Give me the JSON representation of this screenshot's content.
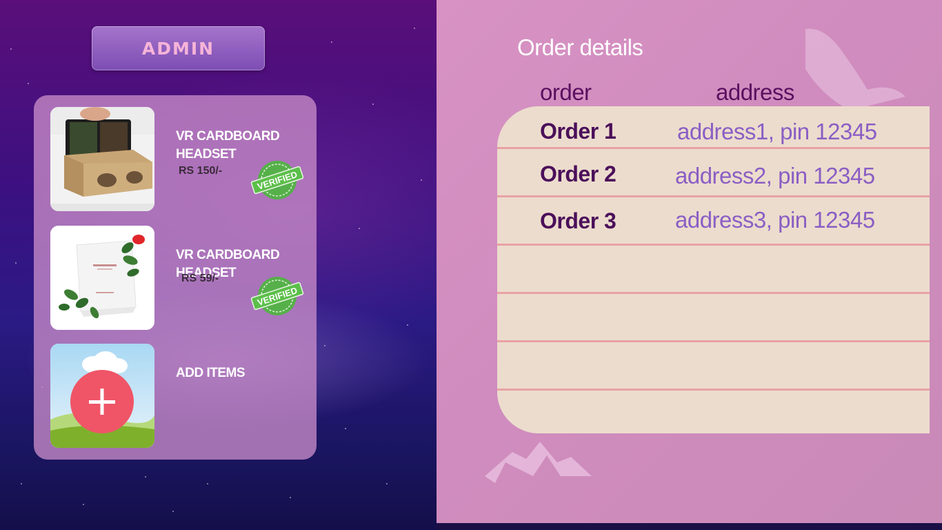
{
  "header": {
    "admin_label": "ADMIN"
  },
  "products": [
    {
      "name": "VR CARDBOARD HEADSET",
      "price": "RS 150/-",
      "badge": "VERIFIED",
      "image_icon": "vr-cardboard-photo"
    },
    {
      "name": "VR CARDBOARD HEADSET",
      "price": "RS 59/-",
      "badge": "VERIFIED",
      "image_icon": "carmesi-box-photo"
    },
    {
      "name": "ADD ITEMS",
      "image_icon": "add-plus-icon"
    }
  ],
  "orders": {
    "title": "Order details",
    "columns": {
      "order": "order",
      "address": "address"
    },
    "rows": [
      {
        "order": "Order 1",
        "address": "address1, pin 12345"
      },
      {
        "order": "Order 2",
        "address": "address2, pin 12345"
      },
      {
        "order": "Order 3",
        "address": "address3, pin 12345"
      },
      {
        "order": "",
        "address": ""
      },
      {
        "order": "",
        "address": ""
      },
      {
        "order": "",
        "address": ""
      },
      {
        "order": "",
        "address": ""
      }
    ]
  },
  "colors": {
    "admin_text": "#f6b4d8",
    "order_text": "#4b0f5a",
    "address_text": "#8a5ec4",
    "table_bg": "#ecdccd",
    "row_line": "#e8a2a5",
    "add_button": "#ef5567",
    "verified_badge": "#4caf50"
  }
}
